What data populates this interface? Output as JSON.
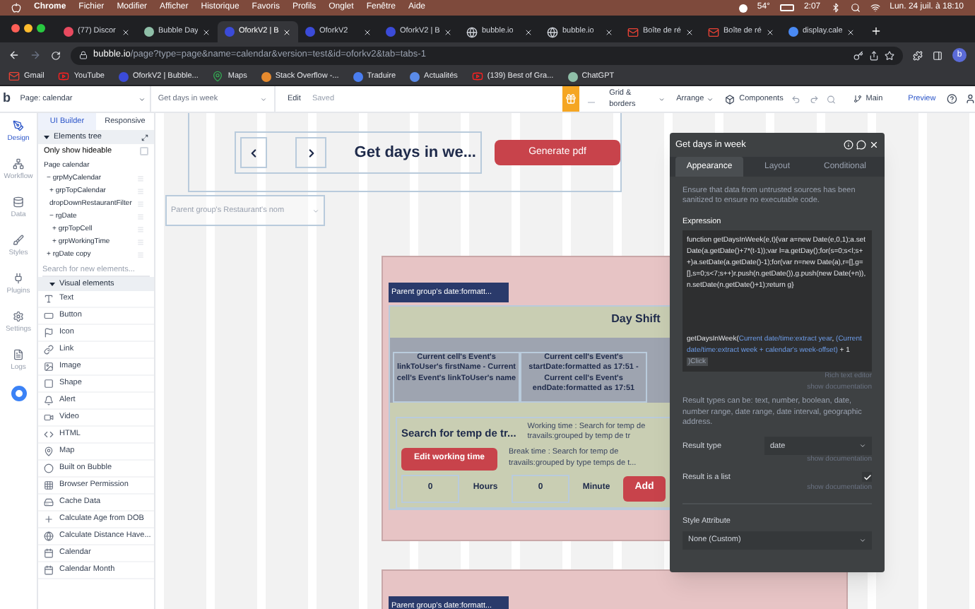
{
  "menubar": {
    "app": "Chrome",
    "items": [
      "Fichier",
      "Modifier",
      "Afficher",
      "Historique",
      "Favoris",
      "Profils",
      "Onglet",
      "Fenêtre",
      "Aide"
    ],
    "temperature": "54°",
    "battery_time": "2:07",
    "clock": "Lun. 24 juil. à 18:10"
  },
  "browser": {
    "tabs": [
      {
        "kind": "discord",
        "title": "(77) Discor",
        "selected": false
      },
      {
        "kind": "bubble-doc",
        "title": "Bubble Day",
        "selected": false
      },
      {
        "kind": "bubble",
        "title": "OforkV2 | B",
        "selected": true
      },
      {
        "kind": "bubble",
        "title": "OforkV2",
        "selected": false
      },
      {
        "kind": "bubble",
        "title": "OforkV2 | B",
        "selected": false
      },
      {
        "kind": "globe",
        "title": "bubble.io",
        "selected": false
      },
      {
        "kind": "globe",
        "title": "bubble.io",
        "selected": false
      },
      {
        "kind": "gmail",
        "title": "Boîte de ré",
        "selected": false
      },
      {
        "kind": "gmail",
        "title": "Boîte de ré",
        "selected": false
      },
      {
        "kind": "google",
        "title": "display.cale",
        "selected": false
      }
    ],
    "url_host": "bubble.io",
    "url_path": "/page?type=page&name=calendar&version=test&id=oforkv2&tab=tabs-1",
    "profile": "b",
    "bookmarks": [
      {
        "kind": "gmail",
        "label": "Gmail"
      },
      {
        "kind": "youtube",
        "label": "YouTube"
      },
      {
        "kind": "bubble",
        "label": "OforkV2 | Bubble..."
      },
      {
        "kind": "maps",
        "label": "Maps"
      },
      {
        "kind": "stack",
        "label": "Stack Overflow -..."
      },
      {
        "kind": "translate",
        "label": "Traduire"
      },
      {
        "kind": "news",
        "label": "Actualités"
      },
      {
        "kind": "youtube",
        "label": "(139) Best of Gra..."
      },
      {
        "kind": "chatgpt",
        "label": "ChatGPT"
      }
    ]
  },
  "toolbar": {
    "logo": "b",
    "page": "Page: calendar",
    "element": "Get days in week",
    "edit": "Edit",
    "saved": "Saved",
    "grid": "Grid & borders",
    "arrange": "Arrange",
    "components": "Components",
    "branch": "Main",
    "preview": "Preview"
  },
  "rail": [
    {
      "kind": "design",
      "label": "Design",
      "selected": true
    },
    {
      "kind": "workflow",
      "label": "Workflow",
      "selected": false
    },
    {
      "kind": "data",
      "label": "Data",
      "selected": false
    },
    {
      "kind": "styles",
      "label": "Styles",
      "selected": false
    },
    {
      "kind": "plugins",
      "label": "Plugins",
      "selected": false
    },
    {
      "kind": "settings",
      "label": "Settings",
      "selected": false
    },
    {
      "kind": "logs",
      "label": "Logs",
      "selected": false
    }
  ],
  "sidebar": {
    "tabs": [
      {
        "label": "UI Builder",
        "selected": true
      },
      {
        "label": "Responsive",
        "selected": false
      }
    ],
    "tree_title": "Elements tree",
    "hideable_label": "Only show hideable",
    "hideable_checked": false,
    "tree": [
      {
        "label": "Page calendar",
        "children": [
          {
            "toggle": "−",
            "label": "grpMyCalendar",
            "children": [
              {
                "toggle": "+",
                "label": "grpTopCalendar"
              },
              {
                "label": "dropDownRestaurantFilter"
              },
              {
                "toggle": "−",
                "label": "rgDate",
                "children": [
                  {
                    "toggle": "+",
                    "label": "grpTopCell"
                  },
                  {
                    "toggle": "+",
                    "label": "grpWorkingTime"
                  }
                ]
              }
            ]
          },
          {
            "toggle": "+",
            "label": "rgDate copy"
          }
        ]
      }
    ],
    "search": {
      "placeholder": "Search for new elements..."
    },
    "section": "Visual elements",
    "elements": [
      {
        "kind": "text",
        "label": "Text"
      },
      {
        "kind": "button",
        "label": "Button"
      },
      {
        "kind": "icon",
        "label": "Icon"
      },
      {
        "kind": "link",
        "label": "Link"
      },
      {
        "kind": "image",
        "label": "Image"
      },
      {
        "kind": "shape",
        "label": "Shape"
      },
      {
        "kind": "alert",
        "label": "Alert"
      },
      {
        "kind": "video",
        "label": "Video"
      },
      {
        "kind": "html",
        "label": "HTML"
      },
      {
        "kind": "map",
        "label": "Map"
      },
      {
        "kind": "bubble",
        "label": "Built on Bubble"
      },
      {
        "kind": "permission",
        "label": "Browser Permission"
      },
      {
        "kind": "cache",
        "label": "Cache Data"
      },
      {
        "kind": "plus",
        "label": "Calculate Age from DOB"
      },
      {
        "kind": "distance",
        "label": "Calculate Distance Have..."
      },
      {
        "kind": "calendar",
        "label": "Calendar"
      },
      {
        "kind": "calendar",
        "label": "Calendar Month"
      }
    ]
  },
  "canvas": {
    "title": "Get days in we...",
    "generate": "Generate pdf",
    "dropdown": "Parent group's Restaurant's nom",
    "groups": [
      {
        "date_label": "Parent group's date:formatt...",
        "heading": "Day Shift",
        "cells": [
          "Current cell's Event's linkToUser's firstName  - Current cell's Event's linkToUser's name",
          "Current cell's Event's startDate:formatted as 17:51  - Current cell's Event's endDate:formatted as 17:51"
        ],
        "search_title": "Search for temp de tr...",
        "working_time": "Working time : Search for temp de travails:grouped by temp de tr",
        "edit_button": "Edit working time",
        "break_time": "Break time : Search for temp de travails:grouped by type temps de t...",
        "hours_value": "0",
        "hours_label": "Hours",
        "minutes_value": "0",
        "minutes_label": "Minute",
        "add_button": "Add"
      },
      {
        "date_label": "Parent group's date:formatt..."
      }
    ]
  },
  "inspector": {
    "title": "Get days in week",
    "tabs": [
      {
        "label": "Appearance",
        "selected": true
      },
      {
        "label": "Layout",
        "selected": false
      },
      {
        "label": "Conditional",
        "selected": false
      }
    ],
    "warning": "Ensure that data from untrusted sources has been sanitized to ensure no executable code.",
    "expression_label": "Expression",
    "code": "function getDaysInWeek(e,t){var a=new Date(e,0,1);a.setDate(a.getDate()+7*(t-1));var l=a.getDay();for(s=0;s<l;s++)a.setDate(a.getDate()-1);for(var n=new Date(a),r=[],g=[],s=0;s<7;s++)r.push(n.getDate()),g.push(new Date(+n)),n.setDate(n.getDate()+1);return g}",
    "call": [
      {
        "kind": "plain",
        "text": "getDaysInWeek("
      },
      {
        "kind": "dynamic",
        "text": "Current date/time:extract year"
      },
      {
        "kind": "plain",
        "text": ", "
      },
      {
        "kind": "dynamic",
        "text": "(Current date/time:extract week + calendar's week-offset)"
      },
      {
        "kind": "plain",
        "text": " + 1 "
      },
      {
        "kind": "chip",
        "text": ")Click"
      }
    ],
    "rich_text": "Rich text editor",
    "show_doc": "show documentation",
    "result_note": "Result types can be: text, number, boolean, date, number range, date range, date interval, geographic address.",
    "result_type_label": "Result type",
    "result_type": "date",
    "result_type_doc": "show documentation",
    "list_label": "Result is a list",
    "list_checked": true,
    "list_doc": "show documentation",
    "style_label": "Style Attribute",
    "style_value": "None (Custom)"
  }
}
